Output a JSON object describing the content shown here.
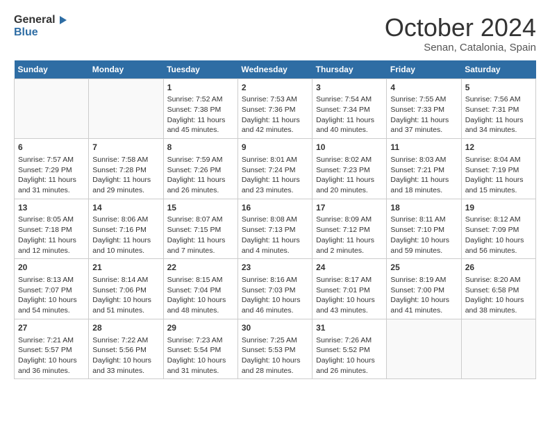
{
  "header": {
    "logo_line1": "General",
    "logo_line2": "Blue",
    "month": "October 2024",
    "location": "Senan, Catalonia, Spain"
  },
  "days_of_week": [
    "Sunday",
    "Monday",
    "Tuesday",
    "Wednesday",
    "Thursday",
    "Friday",
    "Saturday"
  ],
  "weeks": [
    [
      {
        "day": "",
        "info": ""
      },
      {
        "day": "",
        "info": ""
      },
      {
        "day": "1",
        "info": "Sunrise: 7:52 AM\nSunset: 7:38 PM\nDaylight: 11 hours and 45 minutes."
      },
      {
        "day": "2",
        "info": "Sunrise: 7:53 AM\nSunset: 7:36 PM\nDaylight: 11 hours and 42 minutes."
      },
      {
        "day": "3",
        "info": "Sunrise: 7:54 AM\nSunset: 7:34 PM\nDaylight: 11 hours and 40 minutes."
      },
      {
        "day": "4",
        "info": "Sunrise: 7:55 AM\nSunset: 7:33 PM\nDaylight: 11 hours and 37 minutes."
      },
      {
        "day": "5",
        "info": "Sunrise: 7:56 AM\nSunset: 7:31 PM\nDaylight: 11 hours and 34 minutes."
      }
    ],
    [
      {
        "day": "6",
        "info": "Sunrise: 7:57 AM\nSunset: 7:29 PM\nDaylight: 11 hours and 31 minutes."
      },
      {
        "day": "7",
        "info": "Sunrise: 7:58 AM\nSunset: 7:28 PM\nDaylight: 11 hours and 29 minutes."
      },
      {
        "day": "8",
        "info": "Sunrise: 7:59 AM\nSunset: 7:26 PM\nDaylight: 11 hours and 26 minutes."
      },
      {
        "day": "9",
        "info": "Sunrise: 8:01 AM\nSunset: 7:24 PM\nDaylight: 11 hours and 23 minutes."
      },
      {
        "day": "10",
        "info": "Sunrise: 8:02 AM\nSunset: 7:23 PM\nDaylight: 11 hours and 20 minutes."
      },
      {
        "day": "11",
        "info": "Sunrise: 8:03 AM\nSunset: 7:21 PM\nDaylight: 11 hours and 18 minutes."
      },
      {
        "day": "12",
        "info": "Sunrise: 8:04 AM\nSunset: 7:19 PM\nDaylight: 11 hours and 15 minutes."
      }
    ],
    [
      {
        "day": "13",
        "info": "Sunrise: 8:05 AM\nSunset: 7:18 PM\nDaylight: 11 hours and 12 minutes."
      },
      {
        "day": "14",
        "info": "Sunrise: 8:06 AM\nSunset: 7:16 PM\nDaylight: 11 hours and 10 minutes."
      },
      {
        "day": "15",
        "info": "Sunrise: 8:07 AM\nSunset: 7:15 PM\nDaylight: 11 hours and 7 minutes."
      },
      {
        "day": "16",
        "info": "Sunrise: 8:08 AM\nSunset: 7:13 PM\nDaylight: 11 hours and 4 minutes."
      },
      {
        "day": "17",
        "info": "Sunrise: 8:09 AM\nSunset: 7:12 PM\nDaylight: 11 hours and 2 minutes."
      },
      {
        "day": "18",
        "info": "Sunrise: 8:11 AM\nSunset: 7:10 PM\nDaylight: 10 hours and 59 minutes."
      },
      {
        "day": "19",
        "info": "Sunrise: 8:12 AM\nSunset: 7:09 PM\nDaylight: 10 hours and 56 minutes."
      }
    ],
    [
      {
        "day": "20",
        "info": "Sunrise: 8:13 AM\nSunset: 7:07 PM\nDaylight: 10 hours and 54 minutes."
      },
      {
        "day": "21",
        "info": "Sunrise: 8:14 AM\nSunset: 7:06 PM\nDaylight: 10 hours and 51 minutes."
      },
      {
        "day": "22",
        "info": "Sunrise: 8:15 AM\nSunset: 7:04 PM\nDaylight: 10 hours and 48 minutes."
      },
      {
        "day": "23",
        "info": "Sunrise: 8:16 AM\nSunset: 7:03 PM\nDaylight: 10 hours and 46 minutes."
      },
      {
        "day": "24",
        "info": "Sunrise: 8:17 AM\nSunset: 7:01 PM\nDaylight: 10 hours and 43 minutes."
      },
      {
        "day": "25",
        "info": "Sunrise: 8:19 AM\nSunset: 7:00 PM\nDaylight: 10 hours and 41 minutes."
      },
      {
        "day": "26",
        "info": "Sunrise: 8:20 AM\nSunset: 6:58 PM\nDaylight: 10 hours and 38 minutes."
      }
    ],
    [
      {
        "day": "27",
        "info": "Sunrise: 7:21 AM\nSunset: 5:57 PM\nDaylight: 10 hours and 36 minutes."
      },
      {
        "day": "28",
        "info": "Sunrise: 7:22 AM\nSunset: 5:56 PM\nDaylight: 10 hours and 33 minutes."
      },
      {
        "day": "29",
        "info": "Sunrise: 7:23 AM\nSunset: 5:54 PM\nDaylight: 10 hours and 31 minutes."
      },
      {
        "day": "30",
        "info": "Sunrise: 7:25 AM\nSunset: 5:53 PM\nDaylight: 10 hours and 28 minutes."
      },
      {
        "day": "31",
        "info": "Sunrise: 7:26 AM\nSunset: 5:52 PM\nDaylight: 10 hours and 26 minutes."
      },
      {
        "day": "",
        "info": ""
      },
      {
        "day": "",
        "info": ""
      }
    ]
  ]
}
